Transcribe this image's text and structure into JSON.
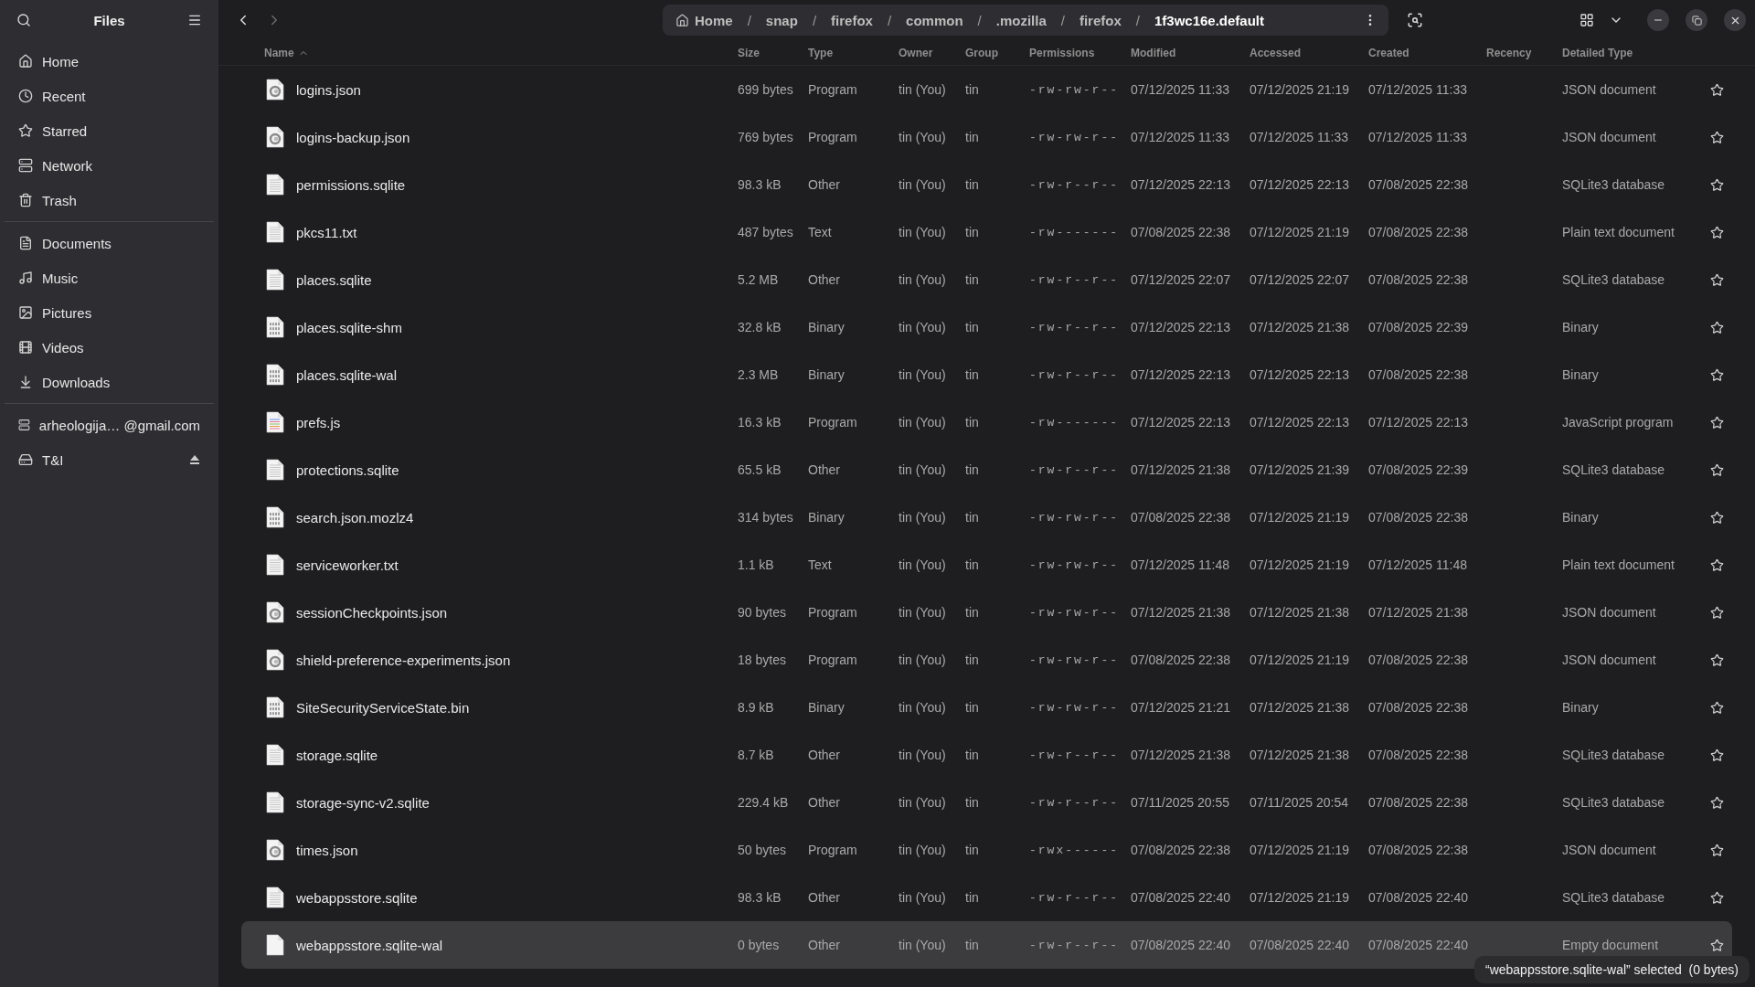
{
  "sidebar": {
    "title": "Files",
    "sections": [
      [
        {
          "label": "Home",
          "selected": false
        },
        {
          "label": "Recent",
          "selected": false
        },
        {
          "label": "Starred",
          "selected": false
        },
        {
          "label": "Network",
          "selected": false
        },
        {
          "label": "Trash",
          "selected": false
        }
      ],
      [
        {
          "label": "Documents",
          "selected": false
        },
        {
          "label": "Music",
          "selected": false
        },
        {
          "label": "Pictures",
          "selected": false
        },
        {
          "label": "Videos",
          "selected": false
        },
        {
          "label": "Downloads",
          "selected": false
        }
      ],
      [
        {
          "label": "arheologija… @gmail.com",
          "selected": false,
          "ejectable": false
        },
        {
          "label": "T&I",
          "selected": false,
          "ejectable": true
        }
      ]
    ]
  },
  "breadcrumb": [
    {
      "label": "Home",
      "current": false
    },
    {
      "separator": "/",
      "label": "snap",
      "current": false
    },
    {
      "separator": "/",
      "label": "firefox",
      "current": false
    },
    {
      "separator": "/",
      "label": "common",
      "current": false
    },
    {
      "separator": "/",
      "label": ".mozilla",
      "current": false
    },
    {
      "separator": "/",
      "label": "firefox",
      "current": false
    },
    {
      "separator": "/",
      "label": "1f3wc16e.default",
      "current": true
    }
  ],
  "columns": [
    {
      "label": "Name",
      "sorted": true
    },
    {
      "label": "Size",
      "sorted": false
    },
    {
      "label": "Type",
      "sorted": false
    },
    {
      "label": "Owner",
      "sorted": false
    },
    {
      "label": "Group",
      "sorted": false
    },
    {
      "label": "Permissions",
      "sorted": false
    },
    {
      "label": "Modified",
      "sorted": false
    },
    {
      "label": "Accessed",
      "sorted": false
    },
    {
      "label": "Created",
      "sorted": false
    },
    {
      "label": "Recency",
      "sorted": false
    },
    {
      "label": "Detailed Type",
      "sorted": false
    }
  ],
  "rows": [
    {
      "kind": "json",
      "name": "logins.json",
      "size": "699 bytes",
      "type": "Program",
      "owner": "tin (You)",
      "group": "tin",
      "permissions": "-rw-rw-r--",
      "modified": "07/12/2025 11:33",
      "accessed": "07/12/2025 21:19",
      "created": "07/12/2025 11:33",
      "detailed_type": "JSON document",
      "starred": false,
      "selected": false
    },
    {
      "kind": "json",
      "name": "logins-backup.json",
      "size": "769 bytes",
      "type": "Program",
      "owner": "tin (You)",
      "group": "tin",
      "permissions": "-rw-rw-r--",
      "modified": "07/12/2025 11:33",
      "accessed": "07/12/2025 11:33",
      "created": "07/12/2025 11:33",
      "detailed_type": "JSON document",
      "starred": false,
      "selected": false
    },
    {
      "kind": "text",
      "name": "permissions.sqlite",
      "size": "98.3 kB",
      "type": "Other",
      "owner": "tin (You)",
      "group": "tin",
      "permissions": "-rw-r--r--",
      "modified": "07/12/2025 22:13",
      "accessed": "07/12/2025 22:13",
      "created": "07/08/2025 22:38",
      "detailed_type": "SQLite3 database",
      "starred": false,
      "selected": false
    },
    {
      "kind": "text",
      "name": "pkcs11.txt",
      "size": "487 bytes",
      "type": "Text",
      "owner": "tin (You)",
      "group": "tin",
      "permissions": "-rw-------",
      "modified": "07/08/2025 22:38",
      "accessed": "07/12/2025 21:19",
      "created": "07/08/2025 22:38",
      "detailed_type": "Plain text document",
      "starred": false,
      "selected": false
    },
    {
      "kind": "text",
      "name": "places.sqlite",
      "size": "5.2 MB",
      "type": "Other",
      "owner": "tin (You)",
      "group": "tin",
      "permissions": "-rw-r--r--",
      "modified": "07/12/2025 22:07",
      "accessed": "07/12/2025 22:07",
      "created": "07/08/2025 22:38",
      "detailed_type": "SQLite3 database",
      "starred": false,
      "selected": false
    },
    {
      "kind": "binary",
      "name": "places.sqlite-shm",
      "size": "32.8 kB",
      "type": "Binary",
      "owner": "tin (You)",
      "group": "tin",
      "permissions": "-rw-r--r--",
      "modified": "07/12/2025 22:13",
      "accessed": "07/12/2025 21:38",
      "created": "07/08/2025 22:39",
      "detailed_type": "Binary",
      "starred": false,
      "selected": false
    },
    {
      "kind": "binary",
      "name": "places.sqlite-wal",
      "size": "2.3 MB",
      "type": "Binary",
      "owner": "tin (You)",
      "group": "tin",
      "permissions": "-rw-r--r--",
      "modified": "07/12/2025 22:13",
      "accessed": "07/12/2025 22:13",
      "created": "07/08/2025 22:38",
      "detailed_type": "Binary",
      "starred": false,
      "selected": false
    },
    {
      "kind": "script",
      "name": "prefs.js",
      "size": "16.3 kB",
      "type": "Program",
      "owner": "tin (You)",
      "group": "tin",
      "permissions": "-rw-------",
      "modified": "07/12/2025 22:13",
      "accessed": "07/12/2025 22:13",
      "created": "07/12/2025 22:13",
      "detailed_type": "JavaScript program",
      "starred": false,
      "selected": false
    },
    {
      "kind": "text",
      "name": "protections.sqlite",
      "size": "65.5 kB",
      "type": "Other",
      "owner": "tin (You)",
      "group": "tin",
      "permissions": "-rw-r--r--",
      "modified": "07/12/2025 21:38",
      "accessed": "07/12/2025 21:39",
      "created": "07/08/2025 22:39",
      "detailed_type": "SQLite3 database",
      "starred": false,
      "selected": false
    },
    {
      "kind": "binary",
      "name": "search.json.mozlz4",
      "size": "314 bytes",
      "type": "Binary",
      "owner": "tin (You)",
      "group": "tin",
      "permissions": "-rw-rw-r--",
      "modified": "07/08/2025 22:38",
      "accessed": "07/12/2025 21:19",
      "created": "07/08/2025 22:38",
      "detailed_type": "Binary",
      "starred": false,
      "selected": false
    },
    {
      "kind": "text",
      "name": "serviceworker.txt",
      "size": "1.1 kB",
      "type": "Text",
      "owner": "tin (You)",
      "group": "tin",
      "permissions": "-rw-rw-r--",
      "modified": "07/12/2025 11:48",
      "accessed": "07/12/2025 21:19",
      "created": "07/12/2025 11:48",
      "detailed_type": "Plain text document",
      "starred": false,
      "selected": false
    },
    {
      "kind": "json",
      "name": "sessionCheckpoints.json",
      "size": "90 bytes",
      "type": "Program",
      "owner": "tin (You)",
      "group": "tin",
      "permissions": "-rw-rw-r--",
      "modified": "07/12/2025 21:38",
      "accessed": "07/12/2025 21:38",
      "created": "07/12/2025 21:38",
      "detailed_type": "JSON document",
      "starred": false,
      "selected": false
    },
    {
      "kind": "json",
      "name": "shield-preference-experiments.json",
      "size": "18 bytes",
      "type": "Program",
      "owner": "tin (You)",
      "group": "tin",
      "permissions": "-rw-rw-r--",
      "modified": "07/08/2025 22:38",
      "accessed": "07/12/2025 21:19",
      "created": "07/08/2025 22:38",
      "detailed_type": "JSON document",
      "starred": false,
      "selected": false
    },
    {
      "kind": "binary",
      "name": "SiteSecurityServiceState.bin",
      "size": "8.9 kB",
      "type": "Binary",
      "owner": "tin (You)",
      "group": "tin",
      "permissions": "-rw-rw-r--",
      "modified": "07/12/2025 21:21",
      "accessed": "07/12/2025 21:38",
      "created": "07/08/2025 22:38",
      "detailed_type": "Binary",
      "starred": false,
      "selected": false
    },
    {
      "kind": "text",
      "name": "storage.sqlite",
      "size": "8.7 kB",
      "type": "Other",
      "owner": "tin (You)",
      "group": "tin",
      "permissions": "-rw-r--r--",
      "modified": "07/12/2025 21:38",
      "accessed": "07/12/2025 21:38",
      "created": "07/08/2025 22:38",
      "detailed_type": "SQLite3 database",
      "starred": false,
      "selected": false
    },
    {
      "kind": "text",
      "name": "storage-sync-v2.sqlite",
      "size": "229.4 kB",
      "type": "Other",
      "owner": "tin (You)",
      "group": "tin",
      "permissions": "-rw-r--r--",
      "modified": "07/11/2025 20:55",
      "accessed": "07/11/2025 20:54",
      "created": "07/08/2025 22:38",
      "detailed_type": "SQLite3 database",
      "starred": false,
      "selected": false
    },
    {
      "kind": "json",
      "name": "times.json",
      "size": "50 bytes",
      "type": "Program",
      "owner": "tin (You)",
      "group": "tin",
      "permissions": "-rwx------",
      "modified": "07/08/2025 22:38",
      "accessed": "07/12/2025 21:19",
      "created": "07/08/2025 22:38",
      "detailed_type": "JSON document",
      "starred": false,
      "selected": false
    },
    {
      "kind": "text",
      "name": "webappsstore.sqlite",
      "size": "98.3 kB",
      "type": "Other",
      "owner": "tin (You)",
      "group": "tin",
      "permissions": "-rw-r--r--",
      "modified": "07/08/2025 22:40",
      "accessed": "07/12/2025 21:19",
      "created": "07/08/2025 22:40",
      "detailed_type": "SQLite3 database",
      "starred": false,
      "selected": false
    },
    {
      "kind": "empty",
      "name": "webappsstore.sqlite-wal",
      "size": "0 bytes",
      "type": "Other",
      "owner": "tin (You)",
      "group": "tin",
      "permissions": "-rw-r--r--",
      "modified": "07/08/2025 22:40",
      "accessed": "07/08/2025 22:40",
      "created": "07/08/2025 22:40",
      "detailed_type": "Empty document",
      "starred": false,
      "selected": true
    }
  ],
  "status": "“webappsstore.sqlite-wal” selected  (0 bytes)"
}
